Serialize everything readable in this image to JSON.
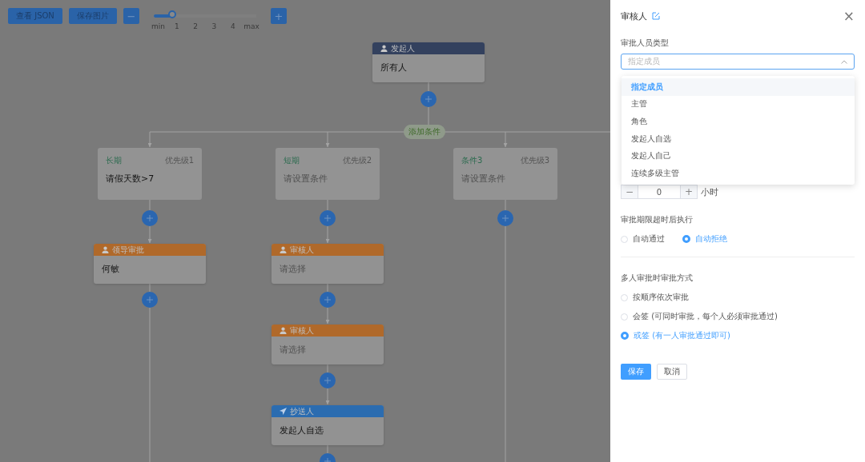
{
  "toolbar": {
    "buttons": [
      "查看 JSON",
      "保存图片"
    ],
    "zoom": {
      "minus": "−",
      "plus": "+",
      "level": 0.2,
      "ticks": [
        "min",
        "1",
        "2",
        "3",
        "4",
        "max"
      ]
    }
  },
  "flow": {
    "start": {
      "kind": "start",
      "title": "发起人",
      "value": "所有人",
      "filled": true
    },
    "add_condition": "添加条件",
    "branches": [
      {
        "condition": {
          "title": "长期",
          "priority": "优先级1",
          "text": "请假天数>7",
          "filled": true
        },
        "nodes": [
          {
            "kind": "approver",
            "title": "领导审批",
            "value": "何敏",
            "filled": true
          }
        ]
      },
      {
        "condition": {
          "title": "短期",
          "priority": "优先级2",
          "text": "请设置条件",
          "filled": false
        },
        "nodes": [
          {
            "kind": "approver",
            "title": "审核人",
            "value": "请选择",
            "filled": false
          },
          {
            "kind": "approver",
            "title": "审核人",
            "value": "请选择",
            "filled": false
          },
          {
            "kind": "cc",
            "title": "抄送人",
            "value": "发起人自选",
            "filled": true
          }
        ]
      },
      {
        "condition": {
          "title": "条件3",
          "priority": "优先级3",
          "text": "请设置条件",
          "filled": false
        }
      }
    ]
  },
  "drawer": {
    "title": "审核人",
    "close": "×",
    "approver_type": {
      "label": "审批人员类型",
      "placeholder": "指定成员",
      "open": true,
      "options": [
        {
          "label": "指定成员",
          "selected": true
        },
        {
          "label": "主管",
          "selected": false
        },
        {
          "label": "角色",
          "selected": false
        },
        {
          "label": "发起人自选",
          "selected": false
        },
        {
          "label": "发起人自己",
          "selected": false
        },
        {
          "label": "连续多级主管",
          "selected": false
        }
      ]
    },
    "timeout": {
      "minus": "−",
      "value": "0",
      "plus": "+",
      "unit": "小时"
    },
    "timeout_action": {
      "label": "审批期限超时后执行",
      "options": [
        {
          "label": "自动通过",
          "selected": false
        },
        {
          "label": "自动拒绝",
          "selected": true
        }
      ]
    },
    "multi_mode": {
      "label": "多人审批时审批方式",
      "options": [
        {
          "label": "按顺序依次审批",
          "selected": false
        },
        {
          "label": "会签 (可同时审批，每个人必须审批通过)",
          "selected": false
        },
        {
          "label": "或签 (有一人审批通过即可)",
          "selected": true
        }
      ]
    },
    "buttons": {
      "save": "保存",
      "cancel": "取消"
    }
  }
}
